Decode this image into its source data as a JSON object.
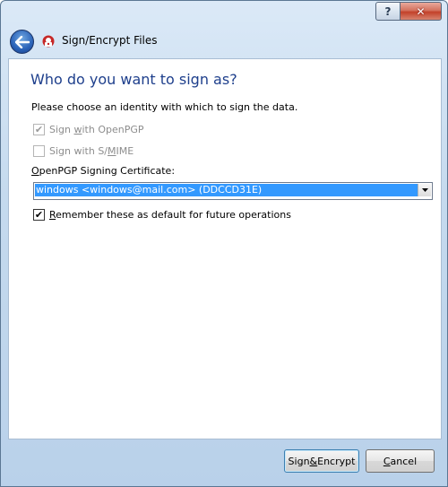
{
  "window": {
    "help_label": "?",
    "close_label": "✕"
  },
  "nav": {
    "title": "Sign/Encrypt Files",
    "back_icon": "back-arrow-icon",
    "app_icon": "kleopatra-icon"
  },
  "page": {
    "heading": "Who do you want to sign as?",
    "instruction": "Please choose an identity with which to sign the data."
  },
  "options": {
    "openpgp": {
      "pre": "Sign ",
      "accel": "w",
      "post": "ith OpenPGP",
      "checked": true,
      "enabled": false
    },
    "smime": {
      "pre": "Sign with S/",
      "accel": "M",
      "post": "IME",
      "checked": false,
      "enabled": false
    }
  },
  "certificate": {
    "label_accel": "O",
    "label_rest": "penPGP Signing Certificate:",
    "selected": "windows <windows@mail.com> (DDCCD31E)"
  },
  "remember": {
    "accel": "R",
    "rest": "emember these as default for future operations",
    "checked": true
  },
  "buttons": {
    "sign_pre": "Sign ",
    "sign_accel": "&",
    "sign_post": " Encrypt",
    "cancel_accel": "C",
    "cancel_rest": "ancel"
  },
  "colors": {
    "heading": "#1e3f8c",
    "selection": "#3399ff",
    "close": "#c3412a"
  }
}
